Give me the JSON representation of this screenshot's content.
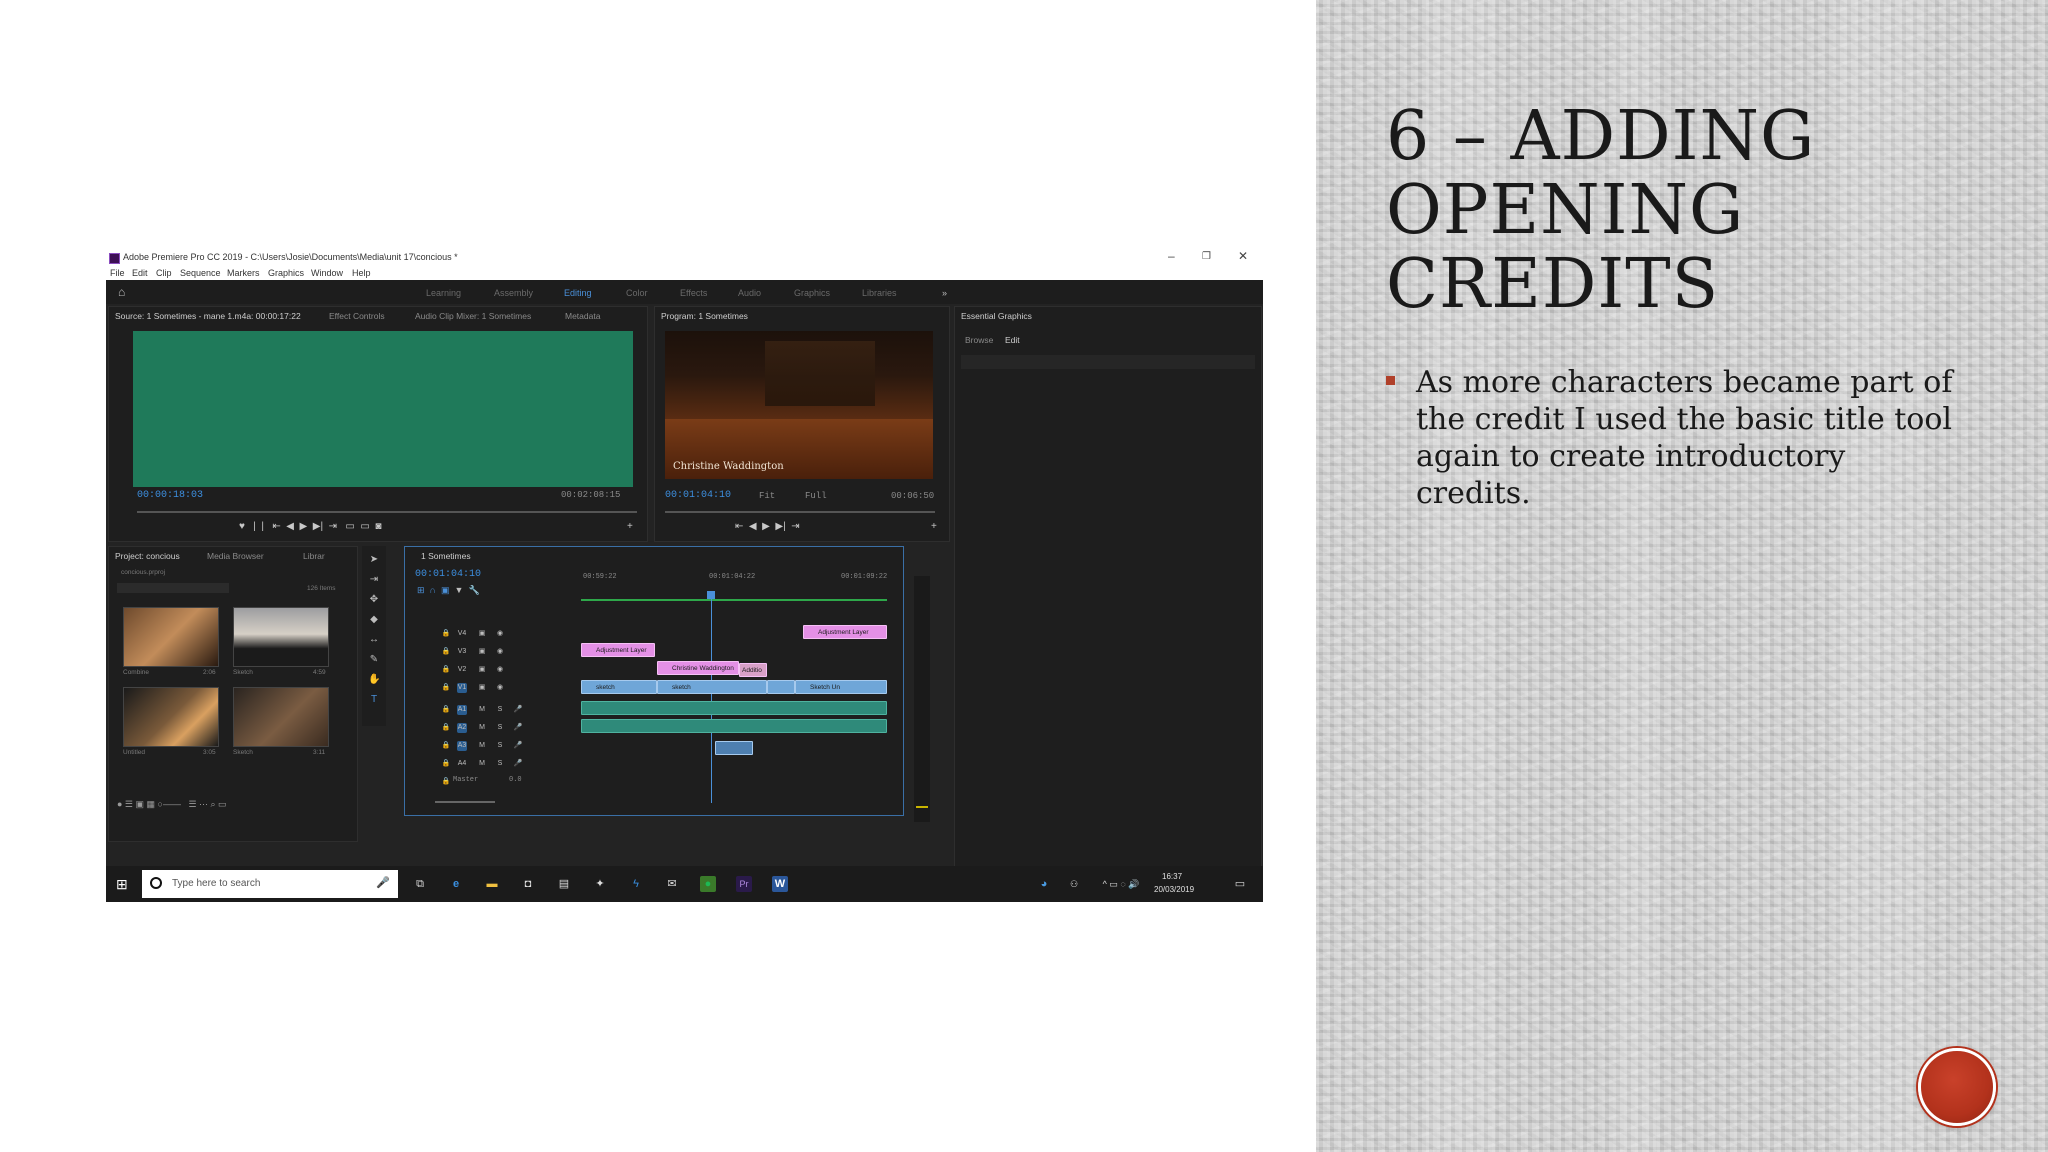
{
  "slide": {
    "title": "6 – ADDING OPENING CREDITS",
    "bullet": "As more characters became part of the credit I used the basic title tool again to create introductory credits."
  },
  "colors": {
    "accent": "#b3321c",
    "timecode": "#3d8fe0",
    "clip_pink": "#e490e6",
    "clip_blue": "#6fa6d8",
    "source_bg": "#1f7a5a"
  },
  "window": {
    "title": "Adobe Premiere Pro CC 2019 - C:\\Users\\Josie\\Documents\\Media\\unit 17\\concious *",
    "menu": [
      "File",
      "Edit",
      "Clip",
      "Sequence",
      "Markers",
      "Graphics",
      "Window",
      "Help"
    ]
  },
  "workspaces": [
    "Learning",
    "Assembly",
    "Editing",
    "Color",
    "Effects",
    "Audio",
    "Graphics",
    "Libraries"
  ],
  "source_panel": {
    "tabs": [
      "Source: 1 Sometimes - mane 1.m4a: 00:00:17:22",
      "Effect Controls",
      "Audio Clip Mixer: 1 Sometimes",
      "Metadata"
    ],
    "timecode": "00:00:18:03",
    "duration": "00:02:08:15"
  },
  "program_panel": {
    "tab": "Program: 1 Sometimes",
    "timecode": "00:01:04:10",
    "fit": "Fit",
    "quality": "Full",
    "duration": "00:06:50",
    "caption": "Christine Waddington"
  },
  "essential_graphics": {
    "title": "Essential Graphics",
    "tabs": [
      "Browse",
      "Edit"
    ]
  },
  "project_panel": {
    "tabs": [
      "Project: concious",
      "Media Browser",
      "Librar"
    ],
    "bin_label": "concious.prproj",
    "item_count": "126 Items",
    "thumbs": [
      {
        "label": "Combine",
        "dur": "2:06"
      },
      {
        "label": "Sketch",
        "dur": "4:59"
      },
      {
        "label": "Untitled",
        "dur": "3:05"
      },
      {
        "label": "Sketch",
        "dur": "3:11"
      }
    ]
  },
  "timeline": {
    "tab": "1 Sometimes",
    "timecode": "00:01:04:10",
    "ruler": [
      "00:59:22",
      "00:01:04:22",
      "00:01:09:22"
    ],
    "tracks": [
      "V4",
      "V3",
      "V2",
      "V1",
      "A1",
      "A2",
      "A3",
      "A4"
    ],
    "master": "Master",
    "master_value": "0.0",
    "clips": {
      "adj1": "Adjustment Layer",
      "adj2": "Adjustment Layer",
      "title": "Christine Waddington",
      "add": "Additio",
      "v1a": "sketch",
      "v1b": "sketch",
      "v1c": "Sketch Un"
    }
  },
  "taskbar": {
    "search_placeholder": "Type here to search",
    "time": "16:37",
    "date": "20/03/2019"
  }
}
